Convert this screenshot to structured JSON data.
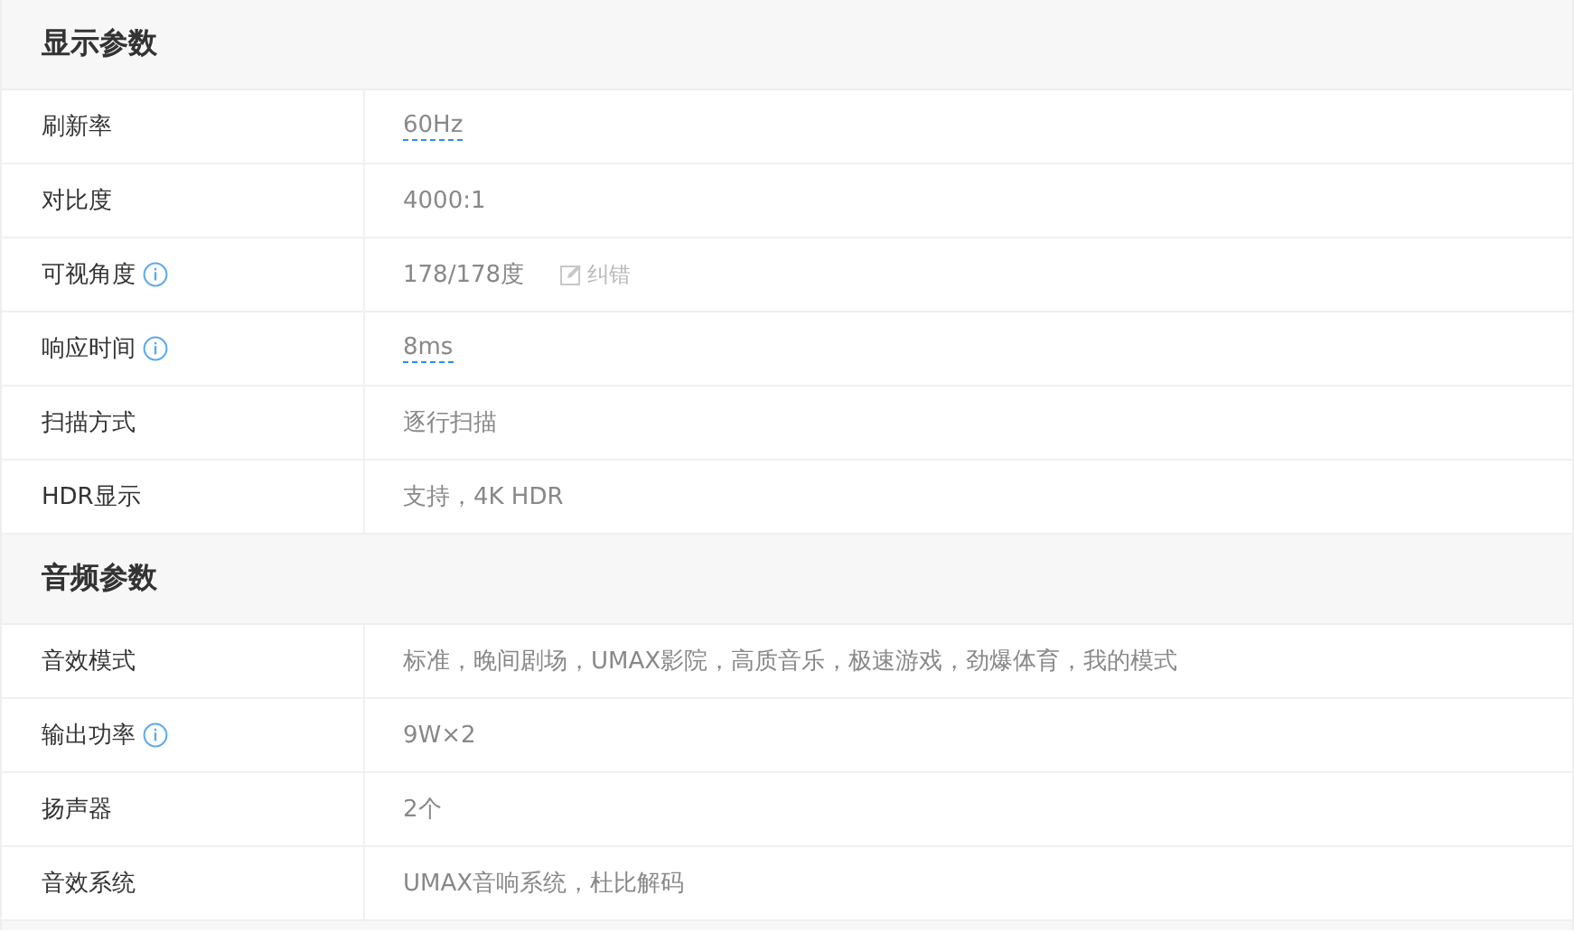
{
  "sections": [
    {
      "title": "显示参数",
      "rows": [
        {
          "label": "刷新率",
          "info": false,
          "value": "60Hz",
          "dashed": true
        },
        {
          "label": "对比度",
          "info": false,
          "value": "4000:1",
          "dashed": false
        },
        {
          "label": "可视角度",
          "info": true,
          "value": "178/178度",
          "dashed": false,
          "correction": "纠错"
        },
        {
          "label": "响应时间",
          "info": true,
          "value": "8ms",
          "dashed": true
        },
        {
          "label": "扫描方式",
          "info": false,
          "value": "逐行扫描",
          "dashed": false
        },
        {
          "label": "HDR显示",
          "info": false,
          "value": "支持，4K HDR",
          "dashed": false
        }
      ]
    },
    {
      "title": "音频参数",
      "rows": [
        {
          "label": "音效模式",
          "info": false,
          "value": "标准，晚间剧场，UMAX影院，高质音乐，极速游戏，劲爆体育，我的模式",
          "dashed": false
        },
        {
          "label": "输出功率",
          "info": true,
          "value": "9W×2",
          "dashed": false
        },
        {
          "label": "扬声器",
          "info": false,
          "value": "2个",
          "dashed": false
        },
        {
          "label": "音效系统",
          "info": false,
          "value": "UMAX音响系统，杜比解码",
          "dashed": false
        }
      ]
    }
  ]
}
